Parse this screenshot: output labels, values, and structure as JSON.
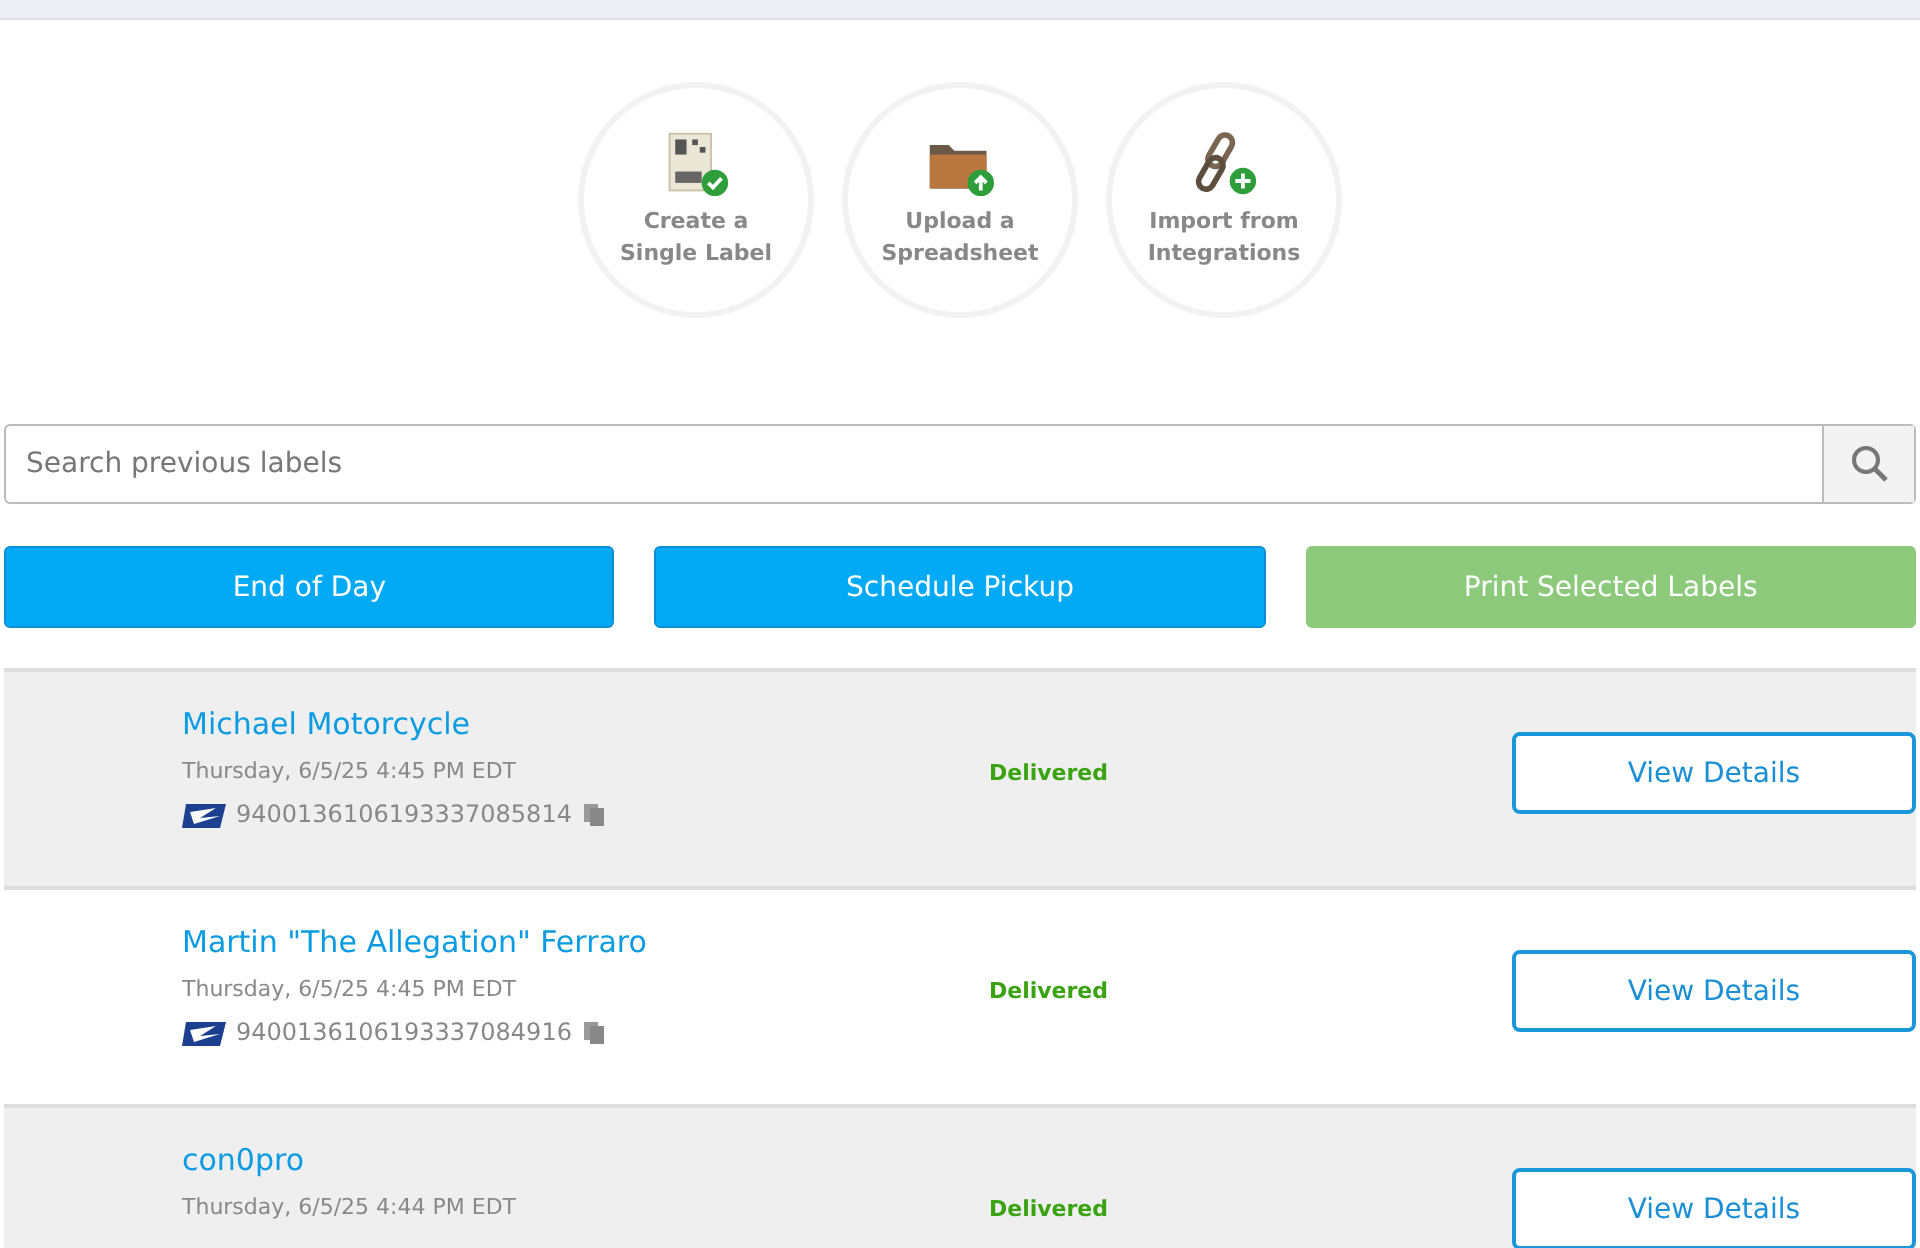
{
  "actions": [
    {
      "kind": "label",
      "line1": "Create a",
      "line2": "Single Label"
    },
    {
      "kind": "upload",
      "line1": "Upload a",
      "line2": "Spreadsheet"
    },
    {
      "kind": "integrations",
      "line1": "Import from",
      "line2": "Integrations"
    }
  ],
  "search": {
    "placeholder": "Search previous labels"
  },
  "buttons": [
    {
      "label": "End of Day",
      "kind": "primary"
    },
    {
      "label": "Schedule Pickup",
      "kind": "primary"
    },
    {
      "label": "Print Selected Labels",
      "kind": "print",
      "disabled": true
    }
  ],
  "shipments": [
    {
      "name": "Michael Motorcycle",
      "date": "Thursday, 6/5/25 4:45 PM EDT",
      "tracking": "9400136106193337085814",
      "status": "Delivered",
      "action": "View Details",
      "shaded": true
    },
    {
      "name": "Martin \"The Allegation\" Ferraro",
      "date": "Thursday, 6/5/25 4:45 PM EDT",
      "tracking": "9400136106193337084916",
      "status": "Delivered",
      "action": "View Details",
      "shaded": false
    },
    {
      "name": "con0pro",
      "date": "Thursday, 6/5/25 4:44 PM EDT",
      "status": "Delivered",
      "action": "View Details",
      "shaded": true
    }
  ]
}
